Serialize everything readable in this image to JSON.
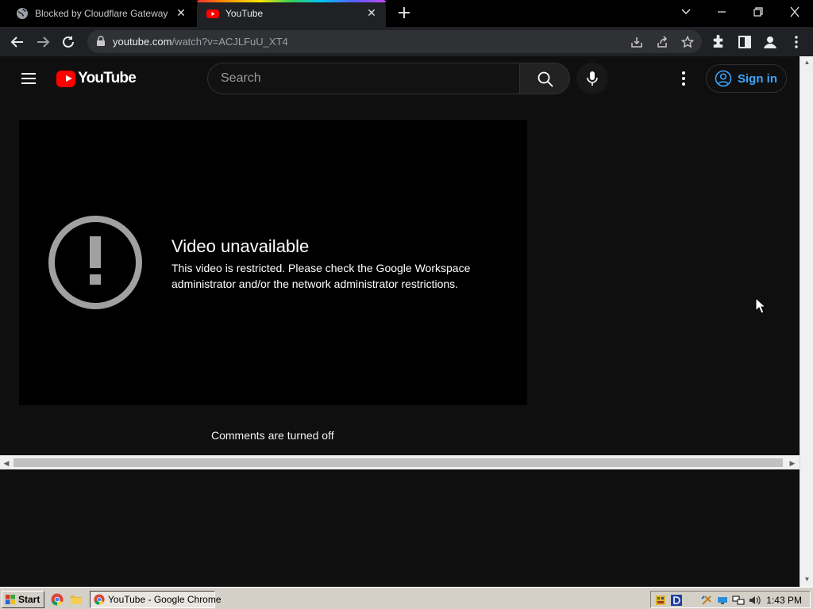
{
  "browser": {
    "tabs": [
      {
        "title": "Blocked by Cloudflare Gateway",
        "active": false,
        "favicon": "globe-icon"
      },
      {
        "title": "YouTube",
        "active": true,
        "favicon": "youtube-icon"
      }
    ],
    "url": {
      "host": "youtube.com",
      "path": "/watch?v=ACJLFuU_XT4"
    },
    "toolbar_icons": [
      "back-icon",
      "forward-icon",
      "reload-icon",
      "lock-icon",
      "install-icon",
      "share-icon",
      "star-icon",
      "extensions-icon",
      "sidepanel-icon",
      "profile-icon",
      "kebab-menu-icon"
    ]
  },
  "youtube": {
    "logo_text": "YouTube",
    "search_placeholder": "Search",
    "sign_in_label": "Sign in",
    "player": {
      "error_title": "Video unavailable",
      "error_message": "This video is restricted. Please check the Google Workspace administrator and/or the network administrator restrictions."
    },
    "comments_text": "Comments are turned off"
  },
  "taskbar": {
    "start_label": "Start",
    "task_label": "YouTube - Google Chrome",
    "clock": "1:43 PM"
  },
  "colors": {
    "yt_red": "#ff0000",
    "link_blue": "#3ea6ff",
    "page_bg": "#0f0f0f"
  }
}
